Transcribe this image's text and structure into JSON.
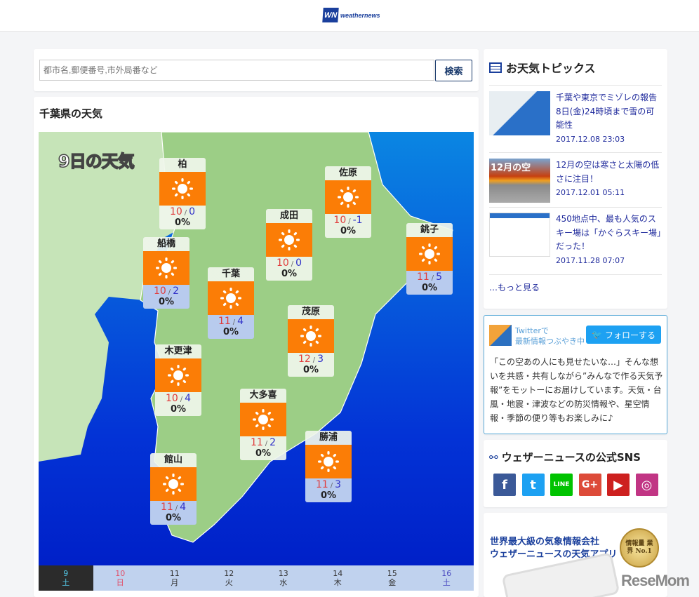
{
  "header": {
    "logo_text": "weathernews",
    "logo_mark": "WN"
  },
  "search": {
    "placeholder": "都市名,郵便番号,市外局番など",
    "button": "検索"
  },
  "section": {
    "title": "千葉県の天気",
    "map_title": "9日の天気"
  },
  "cities": [
    {
      "name": "柏",
      "high": "10",
      "low": "0",
      "pop": "0%",
      "icon": "sun-icon"
    },
    {
      "name": "佐原",
      "high": "10",
      "low": "-1",
      "pop": "0%",
      "icon": "sun-icon"
    },
    {
      "name": "成田",
      "high": "10",
      "low": "0",
      "pop": "0%",
      "icon": "sun-icon"
    },
    {
      "name": "銚子",
      "high": "11",
      "low": "5",
      "pop": "0%",
      "icon": "sun-icon"
    },
    {
      "name": "船橋",
      "high": "10",
      "low": "2",
      "pop": "0%",
      "icon": "sun-icon"
    },
    {
      "name": "千葉",
      "high": "11",
      "low": "4",
      "pop": "0%",
      "icon": "sun-icon"
    },
    {
      "name": "茂原",
      "high": "12",
      "low": "3",
      "pop": "0%",
      "icon": "sun-icon"
    },
    {
      "name": "木更津",
      "high": "10",
      "low": "4",
      "pop": "0%",
      "icon": "sun-icon"
    },
    {
      "name": "大多喜",
      "high": "11",
      "low": "2",
      "pop": "0%",
      "icon": "sun-icon"
    },
    {
      "name": "勝浦",
      "high": "11",
      "low": "3",
      "pop": "0%",
      "icon": "sun-icon"
    },
    {
      "name": "館山",
      "high": "11",
      "low": "4",
      "pop": "0%",
      "icon": "sun-icon"
    }
  ],
  "days": [
    {
      "date": "9",
      "dow": "土"
    },
    {
      "date": "10",
      "dow": "日"
    },
    {
      "date": "11",
      "dow": "月"
    },
    {
      "date": "12",
      "dow": "火"
    },
    {
      "date": "13",
      "dow": "水"
    },
    {
      "date": "14",
      "dow": "木"
    },
    {
      "date": "15",
      "dow": "金"
    },
    {
      "date": "16",
      "dow": "土"
    }
  ],
  "topics": {
    "title": "お天気トピックス",
    "items": [
      {
        "title": "千葉や東京でミゾレの報告　8日(金)24時頃まで雪の可能性",
        "date": "2017.12.08 23:03"
      },
      {
        "title": "12月の空は寒さと太陽の低さに注目！",
        "date": "2017.12.01 05:11",
        "thumb_text": "12月の空"
      },
      {
        "title": "450地点中、最も人気のスキー場は「かぐらスキー場」だった！",
        "date": "2017.11.28 07:07"
      }
    ],
    "more": "…もっと見る"
  },
  "twitter": {
    "line1": "Twitterで",
    "line2": "最新情報つぶやき中",
    "follow": "フォローする",
    "body": "「この空あの人にも見せたいな…」そんな想いを共感・共有しながら”みんなで作る天気予報”をモットーにお届けしています。天気・台風・地震・津波などの防災情報や、星空情報・季節の便り等もお楽しみに♪"
  },
  "sns": {
    "title": "ウェザーニュースの公式SNS",
    "items": [
      {
        "name": "facebook",
        "label": "f",
        "color": "#3b5998"
      },
      {
        "name": "twitter",
        "label": "t",
        "color": "#1da1f2"
      },
      {
        "name": "line",
        "label": "LINE",
        "color": "#00c300"
      },
      {
        "name": "google-plus",
        "label": "G+",
        "color": "#dd4b39"
      },
      {
        "name": "youtube",
        "label": "▶",
        "color": "#cd201f"
      },
      {
        "name": "instagram",
        "label": "◎",
        "color": "#c13584"
      }
    ]
  },
  "ad": {
    "line1": "世界最大級の気象情報会社",
    "line2": "ウェザーニュースの天気アプリ",
    "badge": "情報量 業界 No.1",
    "watermark": "ReseMom"
  }
}
